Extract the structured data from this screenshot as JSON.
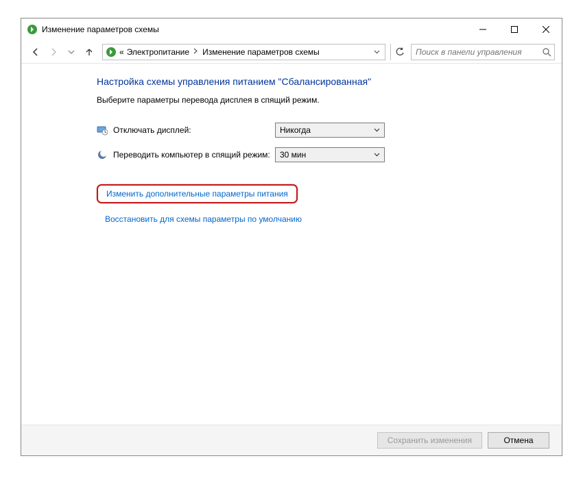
{
  "window": {
    "title": "Изменение параметров схемы"
  },
  "breadcrumb": {
    "prefix": "«",
    "items": [
      "Электропитание",
      "Изменение параметров схемы"
    ]
  },
  "search": {
    "placeholder": "Поиск в панели управления"
  },
  "page": {
    "title": "Настройка схемы управления питанием \"Сбалансированная\"",
    "subtitle": "Выберите параметры перевода дисплея в спящий режим."
  },
  "settings": [
    {
      "label": "Отключать дисплей:",
      "value": "Никогда"
    },
    {
      "label": "Переводить компьютер в спящий режим:",
      "value": "30 мин"
    }
  ],
  "links": {
    "advanced": "Изменить дополнительные параметры питания",
    "restore": "Восстановить для схемы параметры по умолчанию"
  },
  "footer": {
    "save": "Сохранить изменения",
    "cancel": "Отмена"
  }
}
